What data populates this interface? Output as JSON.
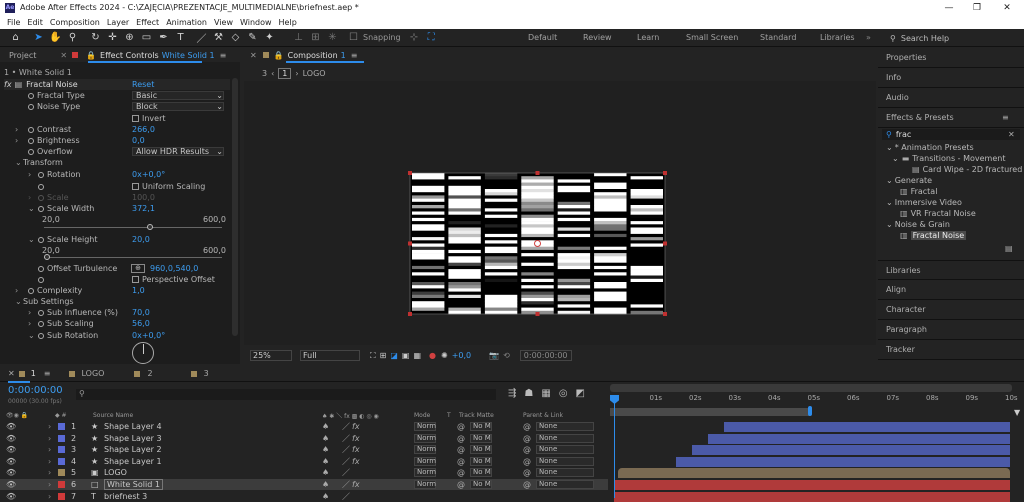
{
  "titlebar": {
    "logo": "Ae",
    "title": "Adobe After Effects 2024 - C:\\ZAJĘCIA\\PREZENTACJE_MULTIMEDIALNE\\briefnest.aep *",
    "min": "—",
    "max": "❐",
    "close": "✕"
  },
  "menu": [
    "File",
    "Edit",
    "Composition",
    "Layer",
    "Effect",
    "Animation",
    "View",
    "Window",
    "Help"
  ],
  "toolbar": {
    "snapping": "Snapping",
    "workspaces": [
      "Default",
      "Review",
      "Learn",
      "Small Screen",
      "Standard",
      "Libraries"
    ],
    "search_help": "Search Help"
  },
  "left_panel": {
    "tab_project": "Project",
    "tab_effect_prefix": "Effect Controls",
    "tab_effect_target": "White Solid 1",
    "layer_path": "1 • White Solid 1",
    "effect_name": "Fractal Noise",
    "reset": "Reset",
    "fractal_type_label": "Fractal Type",
    "fractal_type_value": "Basic",
    "noise_type_label": "Noise Type",
    "noise_type_value": "Block",
    "invert_label": "Invert",
    "contrast_label": "Contrast",
    "contrast_value": "266,0",
    "brightness_label": "Brightness",
    "brightness_value": "0,0",
    "overflow_label": "Overflow",
    "overflow_value": "Allow HDR Results",
    "transform_label": "Transform",
    "rotation_label": "Rotation",
    "rotation_value": "0x+0,0°",
    "uniform_scaling_label": "Uniform Scaling",
    "scale_label": "Scale",
    "scale_value": "100,0",
    "scale_width_label": "Scale Width",
    "scale_width_value": "372,1",
    "sw_min": "20,0",
    "sw_max": "600,0",
    "scale_height_label": "Scale Height",
    "scale_height_value": "20,0",
    "sh_min": "20,0",
    "sh_max": "600,0",
    "offset_label": "Offset Turbulence",
    "offset_value": "960,0,540,0",
    "perspective_label": "Perspective Offset",
    "complexity_label": "Complexity",
    "complexity_value": "1,0",
    "sub_settings_label": "Sub Settings",
    "sub_influence_label": "Sub Influence (%)",
    "sub_influence_value": "70,0",
    "sub_scaling_label": "Sub Scaling",
    "sub_scaling_value": "56,0",
    "sub_rotation_label": "Sub Rotation",
    "sub_rotation_value": "0x+0,0°"
  },
  "comp_panel": {
    "tab_label": "Composition",
    "tab_number": "1",
    "breadcrumb_num": "3",
    "breadcrumb_active": "1",
    "breadcrumb_logo": "LOGO",
    "zoom": "25%",
    "resolution": "Full",
    "exposure": "+0,0",
    "timecode": "0:00:00:00"
  },
  "right_panel": {
    "items_top": [
      "Properties",
      "Info",
      "Audio"
    ],
    "effects_presets": "Effects & Presets",
    "search_value": "frac",
    "tree": [
      {
        "text": "* Animation Presets",
        "indent": 1
      },
      {
        "text": "Transitions - Movement",
        "indent": 2
      },
      {
        "text": "Card Wipe - 2D fractured",
        "indent": 3
      },
      {
        "text": "Generate",
        "indent": 1
      },
      {
        "text": "Fractal",
        "indent": 2
      },
      {
        "text": "Immersive Video",
        "indent": 1
      },
      {
        "text": "VR Fractal Noise",
        "indent": 2
      },
      {
        "text": "Noise & Grain",
        "indent": 1
      },
      {
        "text": "Fractal Noise",
        "indent": 2
      }
    ],
    "items_bottom": [
      "Libraries",
      "Align",
      "Character",
      "Paragraph",
      "Tracker"
    ]
  },
  "timeline": {
    "tabs": [
      {
        "num": "1",
        "name": ""
      },
      {
        "num": "",
        "name": "LOGO"
      },
      {
        "num": "",
        "name": "2"
      },
      {
        "num": "",
        "name": "3"
      }
    ],
    "timecode": "0:00:00:00",
    "fps": "00000 (30.00 fps)",
    "col_source": "Source Name",
    "col_mode": "Mode",
    "col_t": "T",
    "col_trackmatte": "Track Matte",
    "col_parent": "Parent & Link",
    "ruler": [
      "0s",
      "01s",
      "02s",
      "03s",
      "04s",
      "05s",
      "06s",
      "07s",
      "08s",
      "09s",
      "10s"
    ],
    "layers": [
      {
        "num": "1",
        "name": "Shape Layer 4",
        "color": "#5a6ad6",
        "mode": "Norm",
        "tm": "No M",
        "parent": "None"
      },
      {
        "num": "2",
        "name": "Shape Layer 3",
        "color": "#5a6ad6",
        "mode": "Norm",
        "tm": "No M",
        "parent": "None"
      },
      {
        "num": "3",
        "name": "Shape Layer 2",
        "color": "#5a6ad6",
        "mode": "Norm",
        "tm": "No M",
        "parent": "None"
      },
      {
        "num": "4",
        "name": "Shape Layer 1",
        "color": "#5a6ad6",
        "mode": "Norm",
        "tm": "No M",
        "parent": "None"
      },
      {
        "num": "5",
        "name": "LOGO",
        "color": "#a08a5a",
        "mode": "Norm",
        "tm": "No M",
        "parent": "None"
      },
      {
        "num": "6",
        "name": "White Solid 1",
        "color": "#d03a3a",
        "mode": "Norm",
        "tm": "No M",
        "parent": "None"
      },
      {
        "num": "7",
        "name": "briefnest 3",
        "color": "#d03a3a",
        "mode": "",
        "tm": "",
        "parent": ""
      }
    ]
  },
  "colors": {
    "accent": "#2d8ceb",
    "shape_bar": "#4b5aa8",
    "logo_bar": "#7a6a52",
    "solid_bar": "#b03a3a"
  }
}
